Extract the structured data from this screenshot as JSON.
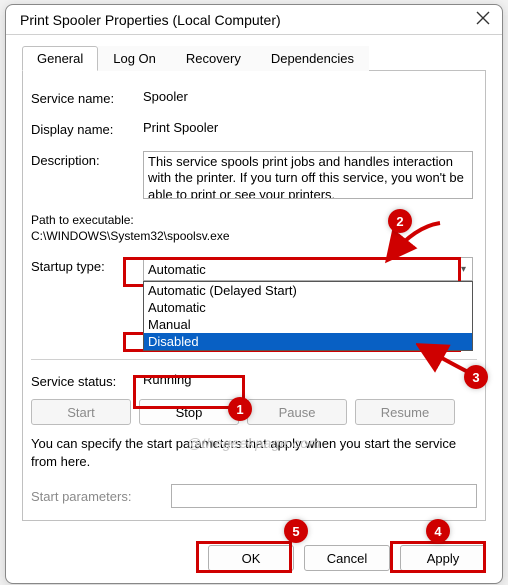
{
  "title": "Print Spooler Properties (Local Computer)",
  "tabs": {
    "general": "General",
    "logon": "Log On",
    "recovery": "Recovery",
    "dependencies": "Dependencies"
  },
  "fields": {
    "service_name_label": "Service name:",
    "service_name_value": "Spooler",
    "display_name_label": "Display name:",
    "display_name_value": "Print Spooler",
    "description_label": "Description:",
    "description_value": "This service spools print jobs and handles interaction with the printer.  If you turn off this service, you won't be able to print or see your printers.",
    "path_label": "Path to executable:",
    "path_value": "C:\\WINDOWS\\System32\\spoolsv.exe",
    "startup_type_label": "Startup type:",
    "startup_selected": "Automatic",
    "startup_options": {
      "delayed": "Automatic (Delayed Start)",
      "automatic": "Automatic",
      "manual": "Manual",
      "disabled": "Disabled"
    },
    "service_status_label": "Service status:",
    "service_status_value": "Running",
    "buttons": {
      "start": "Start",
      "stop": "Stop",
      "pause": "Pause",
      "resume": "Resume"
    },
    "note": "You can specify the start parameters that apply when you start the service from here.",
    "start_params_label": "Start parameters:"
  },
  "dialog_buttons": {
    "ok": "OK",
    "cancel": "Cancel",
    "apply": "Apply"
  },
  "annotations": {
    "m1": "1",
    "m2": "2",
    "m3": "3",
    "m4": "4",
    "m5": "5"
  },
  "watermark": "@thegeekpage.com"
}
